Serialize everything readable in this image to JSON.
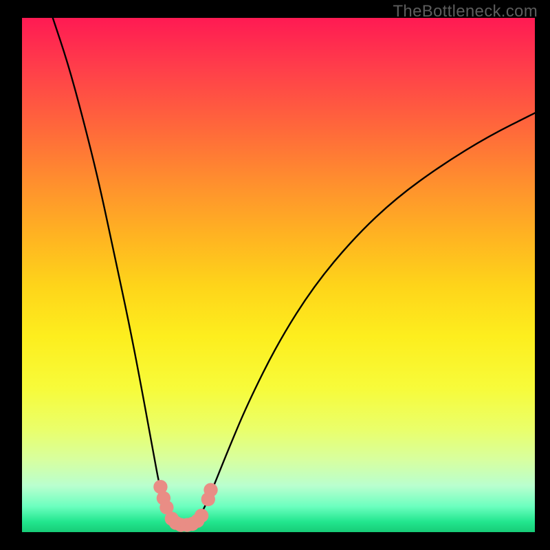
{
  "watermark_text": "TheBottleneck.com",
  "chart_data": {
    "type": "line",
    "title": "",
    "xlabel": "",
    "ylabel": "",
    "xlim": [
      0,
      100
    ],
    "ylim": [
      0,
      100
    ],
    "series": [
      {
        "name": "curve",
        "points_xy": [
          [
            6.0,
            100.0
          ],
          [
            9.0,
            91.0
          ],
          [
            12.0,
            80.0
          ],
          [
            15.0,
            68.0
          ],
          [
            18.0,
            54.0
          ],
          [
            21.0,
            40.0
          ],
          [
            23.5,
            27.0
          ],
          [
            25.5,
            16.0
          ],
          [
            27.0,
            8.0
          ],
          [
            28.5,
            3.5
          ],
          [
            30.5,
            1.5
          ],
          [
            33.0,
            1.5
          ],
          [
            35.0,
            3.5
          ],
          [
            37.0,
            8.0
          ],
          [
            40.0,
            15.5
          ],
          [
            44.0,
            25.0
          ],
          [
            50.0,
            37.0
          ],
          [
            57.0,
            48.0
          ],
          [
            65.0,
            57.5
          ],
          [
            73.0,
            65.0
          ],
          [
            82.0,
            71.5
          ],
          [
            91.0,
            77.0
          ],
          [
            100.0,
            81.5
          ]
        ]
      }
    ],
    "markers": [
      {
        "x": 27.0,
        "y": 8.8,
        "r": 1.3
      },
      {
        "x": 27.6,
        "y": 6.6,
        "r": 1.3
      },
      {
        "x": 28.2,
        "y": 4.8,
        "r": 1.3
      },
      {
        "x": 29.2,
        "y": 2.6,
        "r": 1.3
      },
      {
        "x": 30.0,
        "y": 1.8,
        "r": 1.3
      },
      {
        "x": 31.0,
        "y": 1.4,
        "r": 1.3
      },
      {
        "x": 32.2,
        "y": 1.4,
        "r": 1.3
      },
      {
        "x": 33.2,
        "y": 1.6,
        "r": 1.3
      },
      {
        "x": 34.2,
        "y": 2.2,
        "r": 1.3
      },
      {
        "x": 35.0,
        "y": 3.2,
        "r": 1.3
      },
      {
        "x": 36.3,
        "y": 6.4,
        "r": 1.3
      },
      {
        "x": 36.8,
        "y": 8.2,
        "r": 1.3
      }
    ],
    "background_gradient": {
      "top": "#ff1a53",
      "bottom": "#17cc77"
    }
  }
}
